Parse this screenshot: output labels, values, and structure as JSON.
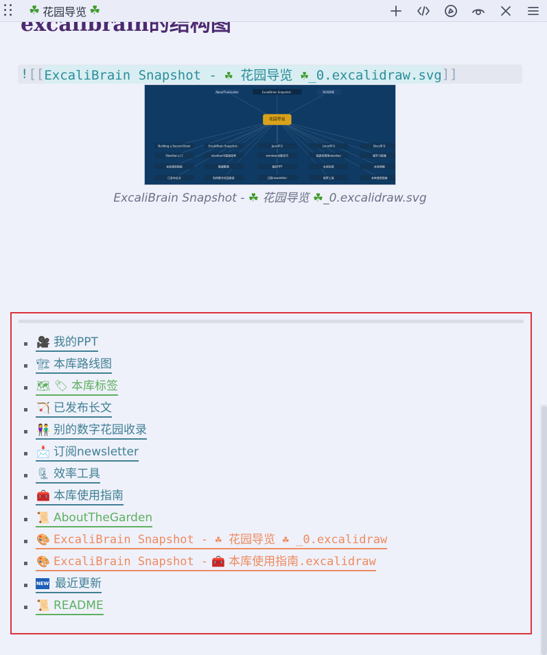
{
  "window": {
    "title": "花园导览",
    "title_icon_left": "clover-icon",
    "title_icon_right": "clover-icon",
    "actions": [
      "plus-icon",
      "code-icon",
      "navigate-icon",
      "preview-eye-icon",
      "close-icon",
      "menu-icon"
    ]
  },
  "content": {
    "heading_partial": "excalibrain的结构图",
    "embed": {
      "bang": "!",
      "open": "[[",
      "text_before": "ExcaliBrain Snapshot - ",
      "title": "花园导览",
      "text_after": "_0.excalidraw.svg",
      "close": "]]"
    },
    "snapshot": {
      "alt": "ExcaliBrain Snapshot graph",
      "center_node": "花园导览",
      "top_nodes": [
        "AboutTheGarden",
        "ExcaliBrain Snapshot -",
        "README"
      ],
      "row1": [
        "Building a Second Brain",
        "ExcaliBrain Snapshot -",
        "Java学习",
        "Linux学习",
        "Docs学习"
      ],
      "row2": [
        "Obsidian入门",
        "obsidian中提高效率",
        "windows功能技巧",
        "我是否想用obsidian",
        "我学习前端"
      ],
      "row3": [
        "本库使用指南",
        "数据整理",
        "我的PPT",
        "本库标签",
        "本库地图"
      ],
      "row4": [
        "已发布长文",
        "别的数字花园收录",
        "订阅newsletter",
        "效率工具",
        "本库使用指南"
      ]
    },
    "caption": {
      "prefix": "ExcaliBrain Snapshot - ",
      "title": "花园导览",
      "suffix": "_0.excalidraw.svg"
    }
  },
  "links": [
    {
      "icon": "🎥",
      "icon_name": "camera-icon",
      "label": "我的PPT",
      "color": "teal",
      "mono": false
    },
    {
      "icon": "🏗",
      "icon_name": "crane-icon",
      "label": "本库路线图",
      "color": "teal",
      "mono": false
    },
    {
      "icon": "🗺",
      "icon_name": "map-icon",
      "icon2": "🏷",
      "icon2_name": "tag-icon",
      "label": "本库标签",
      "color": "green",
      "mono": false
    },
    {
      "icon": "🏹",
      "icon_name": "bow-icon",
      "label": "已发布长文",
      "color": "teal",
      "mono": false
    },
    {
      "icon": "👫",
      "icon_name": "people-icon",
      "label": "别的数字花园收录",
      "color": "teal",
      "mono": false
    },
    {
      "icon": "📩",
      "icon_name": "envelope-icon",
      "label": "订阅newsletter",
      "color": "teal",
      "mono": false
    },
    {
      "icon": "🗜",
      "icon_name": "clamp-icon",
      "label": "效率工具",
      "color": "teal",
      "mono": false
    },
    {
      "icon": "🧰",
      "icon_name": "toolbox-icon",
      "label": "本库使用指南",
      "color": "teal",
      "mono": false
    },
    {
      "icon": "📜",
      "icon_name": "scroll-icon",
      "label": "AboutTheGarden",
      "color": "green",
      "mono": false
    },
    {
      "icon": "🎨",
      "icon_name": "palette-icon",
      "label_before": "ExcaliBrain Snapshot - ",
      "icon2": "☘",
      "icon2_name": "clover-icon",
      "label_mid": "花园导览",
      "icon3": "☘",
      "icon3_name": "clover-icon",
      "label_after": "_0.excalidraw",
      "color": "orange",
      "mono": true
    },
    {
      "icon": "🎨",
      "icon_name": "palette-icon",
      "label_before": "ExcaliBrain Snapshot - ",
      "icon2": "🧰",
      "icon2_name": "toolbox-icon",
      "label_mid": "本库使用指南.excalidraw",
      "color": "orange",
      "mono": true
    },
    {
      "icon": "NEW",
      "icon_name": "new-badge-icon",
      "label": "最近更新",
      "color": "teal",
      "mono": false
    },
    {
      "icon": "📜",
      "icon_name": "scroll-icon",
      "label": "README",
      "color": "green",
      "mono": false
    }
  ],
  "colors": {
    "background": "#eff1fa",
    "link_teal": "#3f7f93",
    "link_green": "#5daf60",
    "link_orange": "#ee8a5f",
    "box_border": "#d9323b",
    "heading": "#4c2a70"
  }
}
